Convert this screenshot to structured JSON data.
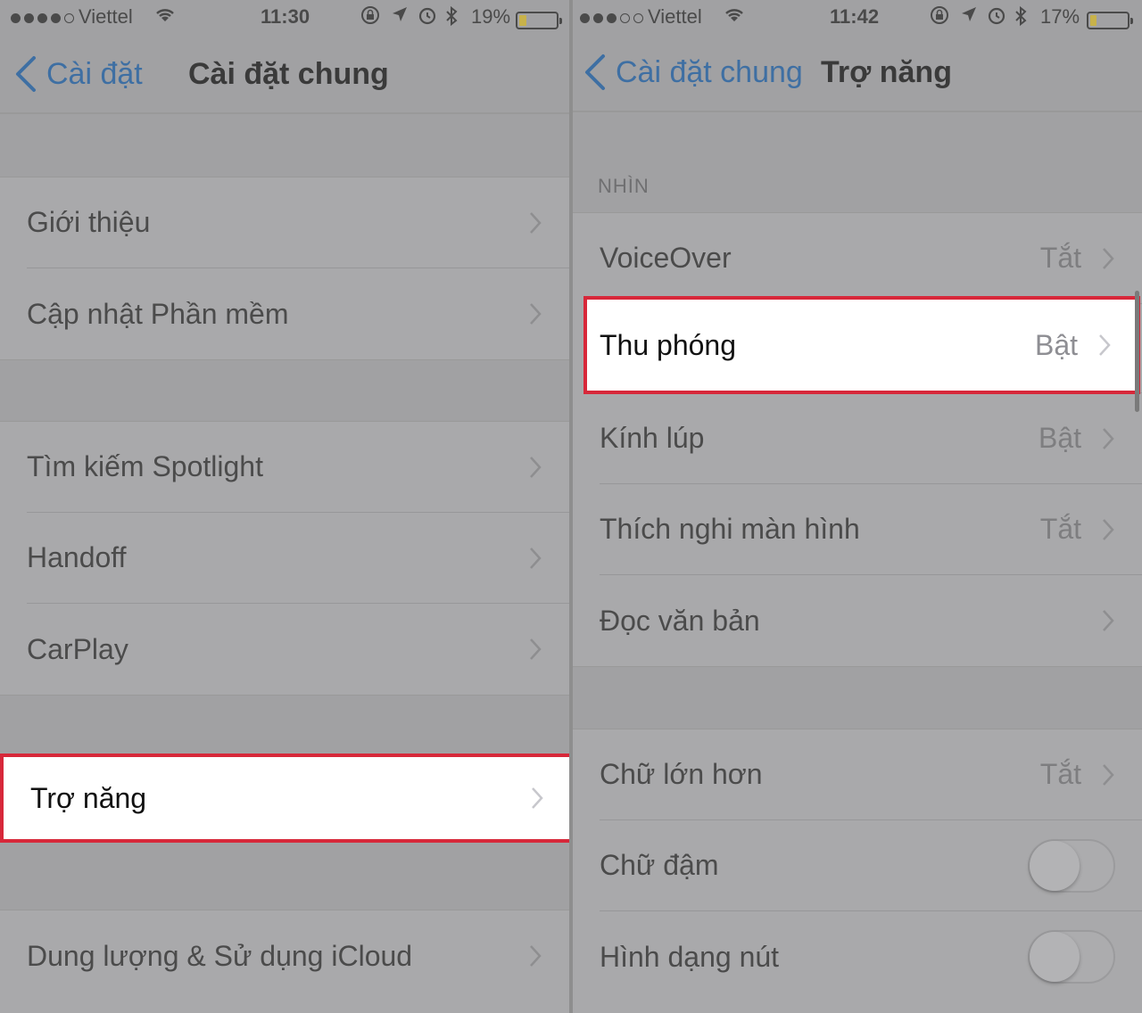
{
  "left": {
    "status": {
      "carrier": "Viettel",
      "time": "11:30",
      "battery": "19%",
      "battery_fill": 0.19
    },
    "nav": {
      "back_label": "Cài đặt",
      "title": "Cài đặt chung"
    },
    "group1": [
      "Giới thiệu",
      "Cập nhật Phần mềm"
    ],
    "group2": [
      "Tìm kiếm Spotlight",
      "Handoff",
      "CarPlay"
    ],
    "highlight": "Trợ năng",
    "group3": [
      "Dung lượng & Sử dụng iCloud"
    ]
  },
  "right": {
    "status": {
      "carrier": "Viettel",
      "time": "11:42",
      "battery": "17%",
      "battery_fill": 0.17
    },
    "nav": {
      "back_label": "Cài đặt chung",
      "title": "Trợ năng"
    },
    "section_header": "NHÌN",
    "voiceover": {
      "label": "VoiceOver",
      "value": "Tắt"
    },
    "highlight": {
      "label": "Thu phóng",
      "value": "Bật"
    },
    "rows": [
      {
        "label": "Kính lúp",
        "value": "Bật"
      },
      {
        "label": "Thích nghi màn hình",
        "value": "Tắt"
      },
      {
        "label": "Đọc văn bản",
        "value": ""
      }
    ],
    "group2": [
      {
        "label": "Chữ lớn hơn",
        "value": "Tắt"
      }
    ],
    "toggles": [
      {
        "label": "Chữ đậm",
        "on": false
      },
      {
        "label": "Hình dạng nút",
        "on": false
      }
    ]
  },
  "colors": {
    "highlight_border": "#d7283a",
    "back_blue": "#3e6fa3",
    "overlay": "#a1a1a3"
  }
}
